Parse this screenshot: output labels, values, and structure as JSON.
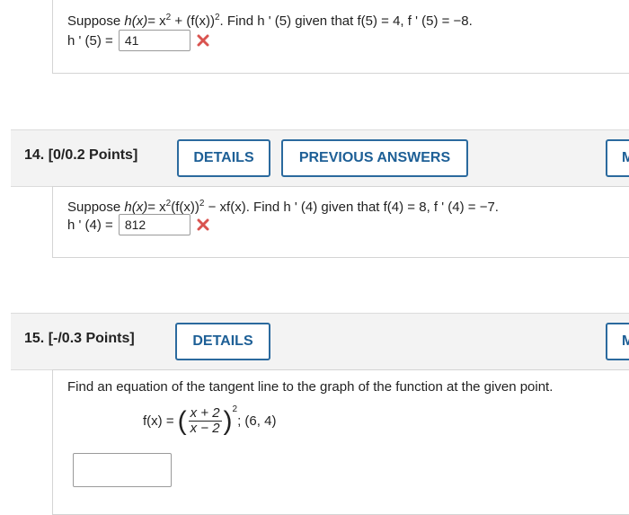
{
  "q13": {
    "prompt_prefix": "Suppose ",
    "h_of_x": "h(x)",
    "eq_rest": "= x",
    "exp1": "2",
    "plus_part": " + (f(x))",
    "exp2": "2",
    "find_text": ". Find h ' (5) given that f(5) = 4, f ' (5) = −8.",
    "answer_label": "h ' (5) =",
    "answer_value": "41"
  },
  "q14": {
    "points_label": "14.  [0/0.2 Points]",
    "details_label": "DETAILS",
    "previous_answers_label": "PREVIOUS ANSWERS",
    "partial_button_label": "M",
    "prompt_prefix": "Suppose ",
    "h_of_x": "h(x)",
    "eq_rest": "= x",
    "exp1": "2",
    "mid_part": "(f(x))",
    "exp2": "2",
    "tail_part": " − xf(x). Find h ' (4) given that f(4) = 8, f ' (4) = −7.",
    "answer_label": "h ' (4) =",
    "answer_value": "812"
  },
  "q15": {
    "points_label": "15.  [-/0.3 Points]",
    "details_label": "DETAILS",
    "partial_button_label": "M",
    "instruction": "Find an equation of the tangent line to the graph of the function at the given point.",
    "f_label": "f(x) =",
    "numerator": "x + 2",
    "denominator": "x − 2",
    "exponent": "2",
    "point": "; (6, 4)",
    "answer_value": ""
  },
  "colors": {
    "accent": "#2b6a9e",
    "incorrect": "#d9534f",
    "header_bg": "#f3f3f3"
  },
  "icons": {
    "incorrect": "x-mark-icon"
  }
}
